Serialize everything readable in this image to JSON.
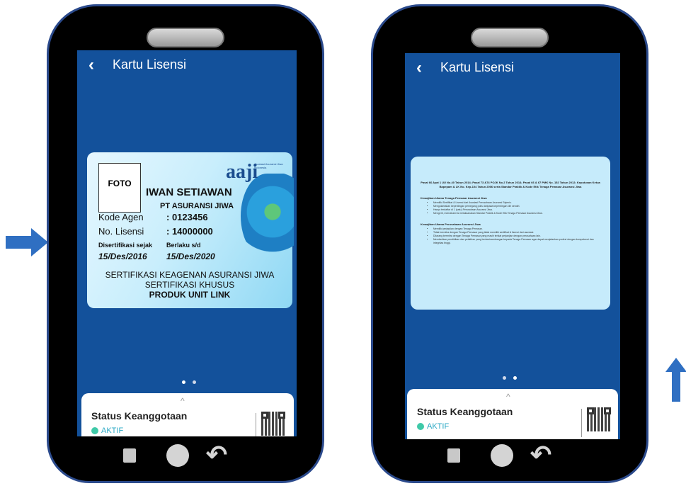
{
  "screen1": {
    "title": "Kartu Lisensi",
    "card": {
      "foto_label": "FOTO",
      "name": "IWAN SETIAWAN",
      "company": "PT ASURANSI JIWA",
      "kode_agen_label": "Kode Agen",
      "kode_agen_value": ": 0123456",
      "no_lisensi_label": "No. Lisensi",
      "no_lisensi_value": ": 14000000",
      "disertifikasi_label": "Disertifikasi sejak",
      "disertifikasi_value": "15/Des/2016",
      "berlaku_label": "Berlaku s/d",
      "berlaku_value": "15/Des/2020",
      "cert_line1": "SERTIFIKASI KEAGENAN ASURANSI JIWA",
      "cert_line2": "SERTIFIKASI KHUSUS",
      "cert_line3": "PRODUK UNIT LINK",
      "logo_text": "aaji",
      "logo_sub": "Asosiasi Asuransi Jiwa Indonesia"
    },
    "status": {
      "title": "Status Keanggotaan",
      "value": "AKTIF"
    }
  },
  "screen2": {
    "title": "Kartu Lisensi",
    "card": {
      "heading": "Pasal 66 Ayat 1 UU No.40 Tahun 2014; Pasal 73 &74 POJK No.2 Tahun 2014; Pasal 66 & 67 PMK No. 152 Tahun 2012; Keputusan Ketua Bapepam & LK No. Kep-104 Tahun 2006 serta Standar Praktik & Kode Etik Tenaga Pemasar Asuransi Jiwa",
      "section1_title": "Kewajiban Utama Tenaga Pemasar Asuransi Jiwa",
      "section1_items": [
        "Memiliki Sertifikat & Lisensi dari Asosiasi Perusahaan Asuransi Sejenis.",
        "Mengutamakan kepentingan pemegang polis daripada kepentingan diri sendiri.",
        "Hanya terdaftar di 1 (satu) Perusahaan Asuransi Jiwa.",
        "Mengerti, memahami & melaksanakan Standar Praktik & Kode Etik Tenaga Pemasar Asuransi Jiwa."
      ],
      "section2_title": "Kewajiban Utama Perusahaan Asuransi Jiwa",
      "section2_items": [
        "Memiliki perjanjian dengan Tenaga Pemasar.",
        "Tidak bermitra dengan Tenaga Pemasar yang tidak memiliki sertifikat & lisensi dari asosiasi.",
        "Dilarang bermitra dengan Tenaga Pemasar yang masih terikat perjanjian dengan perusahaan lain.",
        "Memberikan pendidikan dan pelatihan yang berkesinambungan kepada Tenaga Pemasar agar dapat menjalankan profesi dengan kompetensi dan integritas tinggi."
      ]
    },
    "status": {
      "title": "Status Keanggotaan",
      "value": "AKTIF"
    }
  },
  "pager": {
    "count": 2
  },
  "colors": {
    "screen_bg": "#13519b",
    "arrow": "#2f6fc2",
    "status_green": "#3fc9a8"
  },
  "icons": {
    "back": "chevron-left",
    "expand": "chevron-up",
    "recent": "recent-apps",
    "home": "home-circle",
    "nav_back": "back-arrow"
  },
  "glyphs": {
    "back": "‹",
    "expand": "^",
    "nav_back": "↶"
  }
}
